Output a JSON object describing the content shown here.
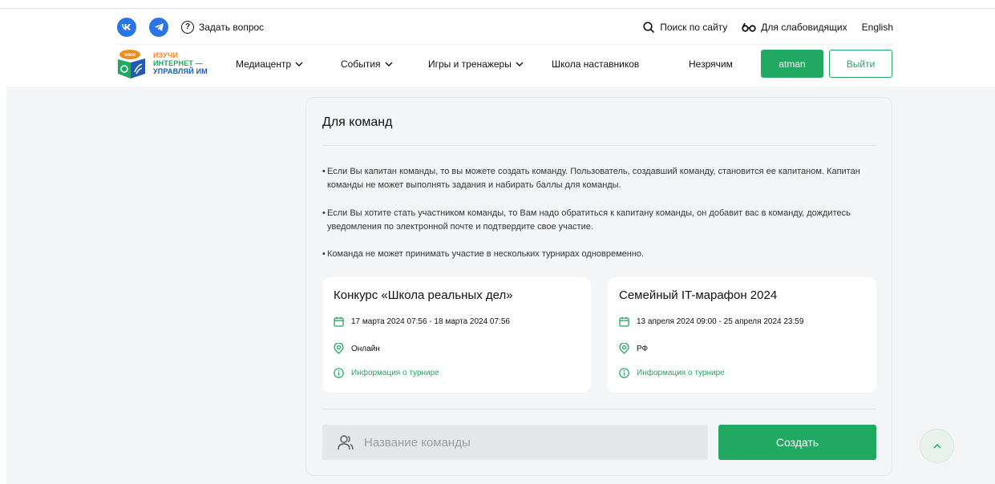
{
  "header": {
    "social": [
      {
        "name": "vk",
        "icon": "vk-icon",
        "color": "#2a75e5"
      },
      {
        "name": "telegram",
        "icon": "telegram-icon",
        "color": "#2a75e5"
      }
    ],
    "ask_label": "Задать вопрос",
    "search_label": "Поиск по сайту",
    "accessibility_label": "Для слабовидящих",
    "language_label": "English",
    "logo": {
      "line1": "ИЗУЧИ",
      "line2": "ИНТЕРНЕТ —",
      "line3": "УПРАВЛЯЙ ИМ",
      "badge": "www"
    },
    "nav": [
      {
        "label": "Медиацентр",
        "has_dropdown": true
      },
      {
        "label": "События",
        "has_dropdown": true
      },
      {
        "label": "Игры и тренажеры",
        "has_dropdown": true
      },
      {
        "label": "Школа наставников",
        "has_dropdown": false
      },
      {
        "label": "Незрячим",
        "has_dropdown": false
      }
    ],
    "user_button": "atman",
    "logout_button": "Выйти"
  },
  "card": {
    "title": "Для команд",
    "rules": [
      "Если Вы капитан команды, то вы можете создать команду. Пользователь, создавший команду, становится ее капитаном. Капитан команды не может выполнять задания и набирать баллы для команды.",
      "Если Вы хотите стать участником команды, то Вам надо обратиться к капитану команды, он добавит вас в команду, дождитесь уведомления по электронной почте и подтвердите свое участие.",
      "Команда не может принимать участие в нескольких турнирах одновременно."
    ],
    "tournaments": [
      {
        "name": "Конкурс «Школа реальных дел»",
        "dates": "17 марта 2024 07:56 - 18 марта 2024 07:56",
        "location": "Онлайн",
        "info_link": "Информация о турнире"
      },
      {
        "name": "Семейный IT-марафон 2024",
        "dates": "13 апреля 2024 09:00 - 25 апреля 2024 23:59",
        "location": "РФ",
        "info_link": "Информация о турнире"
      }
    ],
    "team_name_placeholder": "Название команды",
    "create_button": "Создать"
  },
  "colors": {
    "accent": "#21a861",
    "vk": "#2a75e5",
    "background": "#f4f5f7"
  }
}
